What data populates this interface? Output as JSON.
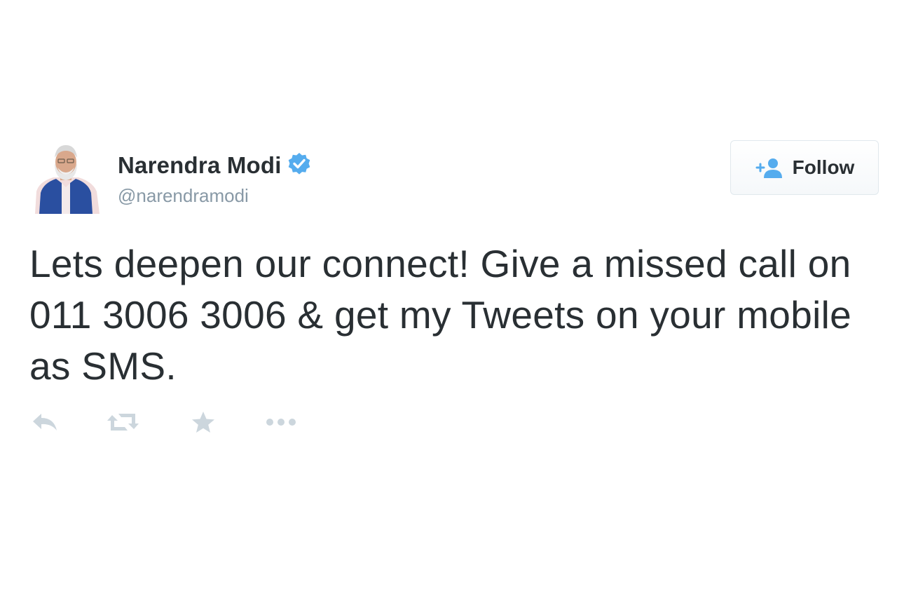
{
  "tweet": {
    "author": {
      "display_name": "Narendra Modi",
      "handle": "@narendramodi",
      "verified": true,
      "avatar_icon": "profile-photo"
    },
    "follow_button": {
      "label": "Follow",
      "icon": "add-user-icon"
    },
    "text": "Lets deepen our connect! Give a missed call on 011 3006 3006 & get my Tweets on your mobile as SMS.",
    "actions": [
      {
        "name": "reply",
        "icon": "reply-icon"
      },
      {
        "name": "retweet",
        "icon": "retweet-icon"
      },
      {
        "name": "favorite",
        "icon": "star-icon"
      },
      {
        "name": "more",
        "icon": "more-icon"
      }
    ]
  },
  "colors": {
    "text": "#292f33",
    "secondary": "#8899a6",
    "verified": "#55acee",
    "action_icons": "#ccd6dd",
    "follow_icon": "#55acee"
  }
}
